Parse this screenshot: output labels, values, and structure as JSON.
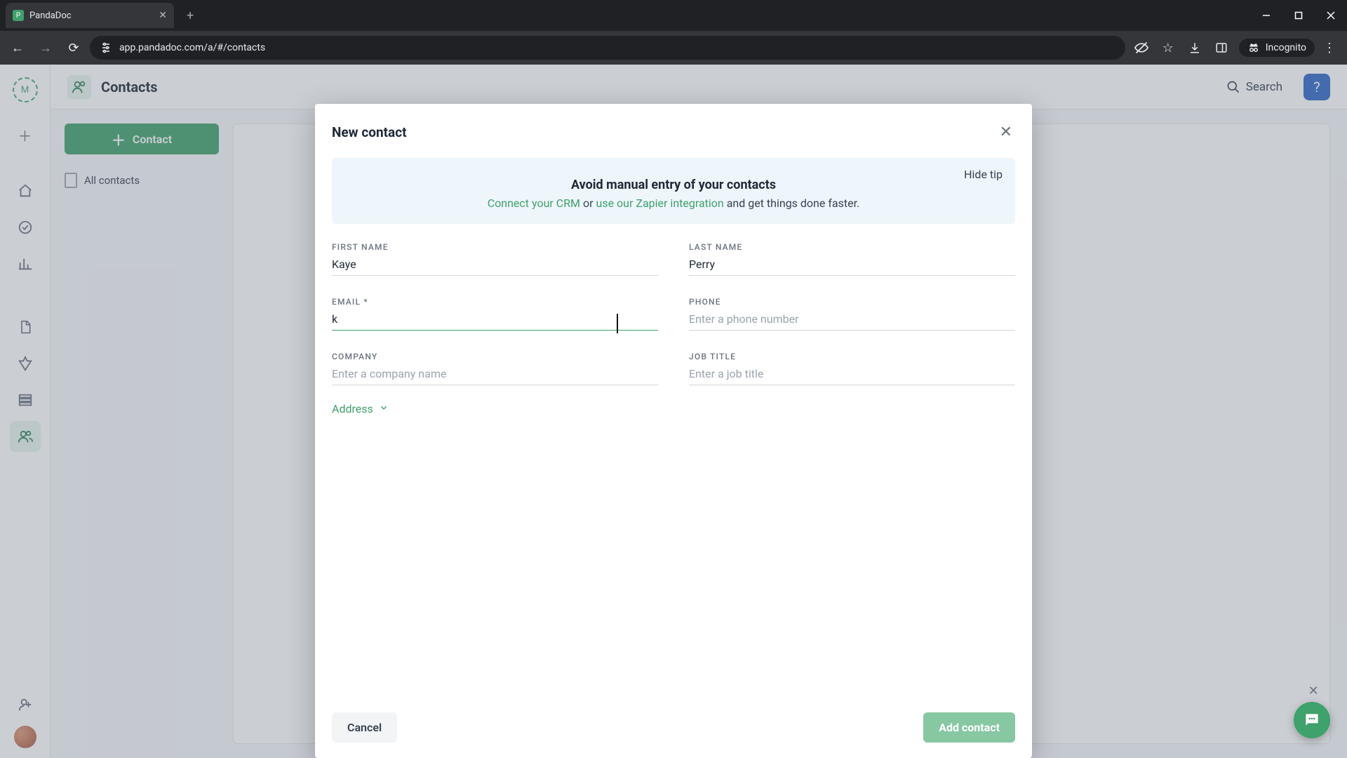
{
  "browser": {
    "tab_title": "PandaDoc",
    "url": "app.pandadoc.com/a/#/contacts",
    "incognito_label": "Incognito"
  },
  "page": {
    "title": "Contacts",
    "search_label": "Search"
  },
  "sidebar": {
    "contact_button_label": "Contact",
    "all_contacts_label": "All contacts"
  },
  "modal": {
    "title": "New contact",
    "tip": {
      "hide_label": "Hide tip",
      "title": "Avoid manual entry of your contacts",
      "link1": "Connect your CRM",
      "middle": " or ",
      "link2": "use our Zapier integration",
      "tail": " and get things done faster."
    },
    "fields": {
      "first_name": {
        "label": "FIRST NAME",
        "value": "Kaye",
        "placeholder": ""
      },
      "last_name": {
        "label": "LAST NAME",
        "value": "Perry",
        "placeholder": ""
      },
      "email": {
        "label": "EMAIL *",
        "value": "k",
        "placeholder": ""
      },
      "phone": {
        "label": "PHONE",
        "value": "",
        "placeholder": "Enter a phone number"
      },
      "company": {
        "label": "COMPANY",
        "value": "",
        "placeholder": "Enter a company name"
      },
      "job_title": {
        "label": "JOB TITLE",
        "value": "",
        "placeholder": "Enter a job title"
      }
    },
    "address_toggle": "Address",
    "cancel_label": "Cancel",
    "submit_label": "Add contact"
  }
}
